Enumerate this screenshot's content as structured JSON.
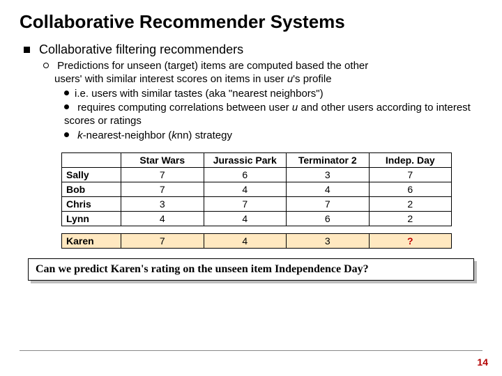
{
  "title": "Collaborative Recommender Systems",
  "bullets": {
    "l1": "Collaborative filtering recommenders",
    "l2a_part1": "Predictions for unseen (target) items are computed based the other",
    "l2a_part2_pre": "users' with similar interest scores on items in user ",
    "l2a_u": "u",
    "l2a_part2_post": "'s profile",
    "l3a": "i.e. users with similar tastes (aka \"nearest neighbors\")",
    "l3b_pre": "requires computing correlations between user ",
    "l3b_u": "u",
    "l3b_post": " and other users according to interest scores or ratings",
    "l3c_k": "k",
    "l3c_mid": "-nearest-neighbor (",
    "l3c_k2": "k",
    "l3c_post": "nn) strategy"
  },
  "chart_data": {
    "type": "table",
    "columns": [
      "Star Wars",
      "Jurassic Park",
      "Terminator 2",
      "Indep. Day"
    ],
    "rows": [
      {
        "name": "Sally",
        "values": [
          7,
          6,
          3,
          7
        ]
      },
      {
        "name": "Bob",
        "values": [
          7,
          4,
          4,
          6
        ]
      },
      {
        "name": "Chris",
        "values": [
          3,
          7,
          7,
          2
        ]
      },
      {
        "name": "Lynn",
        "values": [
          4,
          4,
          6,
          2
        ]
      }
    ],
    "query_row": {
      "name": "Karen",
      "values": [
        7,
        4,
        3
      ],
      "unknown": "?"
    }
  },
  "caption": "Can we predict Karen's rating on the unseen item Independence Day?",
  "page_number": "14"
}
